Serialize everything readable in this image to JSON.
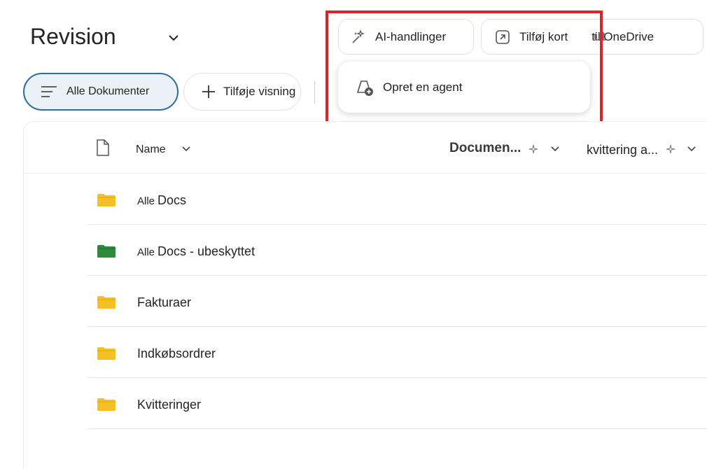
{
  "page": {
    "title": "Revision"
  },
  "toolbar": {
    "ai_actions_label": "AI-handlinger",
    "add_card_label": "Tilføj kort",
    "onedrive_ghost": "ut",
    "onedrive_label": "til OneDrive"
  },
  "views": {
    "current_label": "Alle Dokumenter",
    "add_view_label": "Tilføje visning"
  },
  "dropdown": {
    "create_agent_label": "Opret en agent"
  },
  "columns": {
    "name": "Name",
    "documents": "Documen...",
    "receipt": "kvittering a..."
  },
  "files": [
    {
      "prefix": "Alle",
      "label": "Docs",
      "color": "#f5c025"
    },
    {
      "prefix": "Alle",
      "label": "Docs - ubeskyttet",
      "color": "#2e8b3e"
    },
    {
      "prefix": "",
      "label": "Fakturaer",
      "color": "#f5c025"
    },
    {
      "prefix": "",
      "label": "Indkøbsordrer",
      "color": "#f5c025"
    },
    {
      "prefix": "",
      "label": "Kvitteringer",
      "color": "#f5c025"
    }
  ],
  "colors": {
    "highlight": "#d9232d",
    "accent": "#2a6e9e"
  }
}
